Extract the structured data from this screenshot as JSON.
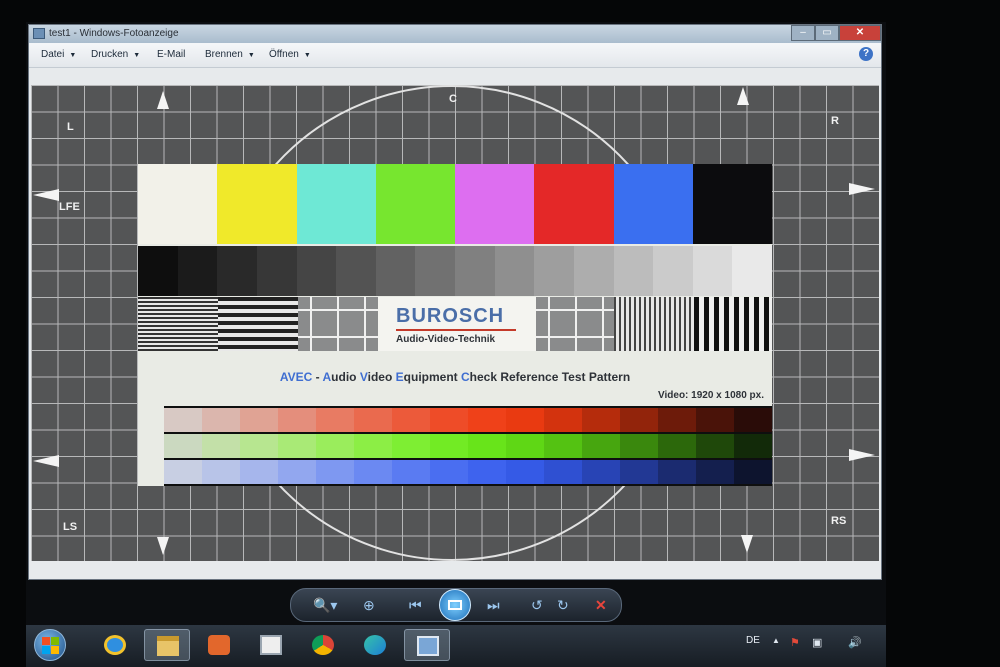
{
  "window": {
    "title": "test1 - Windows-Fotoanzeige",
    "controls": {
      "minimize": "–",
      "maximize": "▭",
      "close": "✕"
    }
  },
  "menubar": {
    "items": [
      {
        "label": "Datei",
        "has_dropdown": true
      },
      {
        "label": "Drucken",
        "has_dropdown": true
      },
      {
        "label": "E-Mail",
        "has_dropdown": false
      },
      {
        "label": "Brennen",
        "has_dropdown": true
      },
      {
        "label": "Öffnen",
        "has_dropdown": true
      }
    ],
    "help_label": "?"
  },
  "test_pattern": {
    "channels": {
      "top_left": "L",
      "top_center": "C",
      "top_right": "R",
      "left_mid": "LFE",
      "bottom_left": "LS",
      "bottom_right": "RS"
    },
    "color_bars": [
      "#f2f1e9",
      "#f0e92a",
      "#6ee8d5",
      "#77e62f",
      "#dd6ef0",
      "#e42828",
      "#3a6ff0",
      "#0c0c0e"
    ],
    "gray_ramp": [
      "#0e0e0e",
      "#1b1b1b",
      "#292929",
      "#373737",
      "#454545",
      "#535353",
      "#626262",
      "#717171",
      "#808080",
      "#8f8f8f",
      "#9e9e9e",
      "#adadad",
      "#bcbcbc",
      "#cbcbcb",
      "#dadada",
      "#e9e9e9"
    ],
    "logo": {
      "name": "BUROSCH",
      "subtitle": "Audio-Video-Technik"
    },
    "tagline": {
      "parts": [
        {
          "text": "AVEC",
          "highlight": true
        },
        {
          "text": " - ",
          "highlight": false
        },
        {
          "text": "A",
          "highlight": true
        },
        {
          "text": "udio ",
          "highlight": false
        },
        {
          "text": "V",
          "highlight": true
        },
        {
          "text": "ideo ",
          "highlight": false
        },
        {
          "text": "E",
          "highlight": true
        },
        {
          "text": "quipment ",
          "highlight": false
        },
        {
          "text": "C",
          "highlight": true
        },
        {
          "text": "heck Reference Test Pattern",
          "highlight": false
        }
      ]
    },
    "resolution": "Video: 1920 x 1080 px.",
    "saturation_ramps": {
      "red": [
        "#d8c9c4",
        "#dbb6ad",
        "#e0a394",
        "#e48e7c",
        "#e87b63",
        "#ea6a4e",
        "#ec5a3a",
        "#ee4c28",
        "#ef4119",
        "#e93a11",
        "#d3330e",
        "#b52c0c",
        "#92240b",
        "#6d1b0a",
        "#4a1309",
        "#2a0c08"
      ],
      "green": [
        "#cbd9c0",
        "#c3e0a8",
        "#b7e690",
        "#a9ea76",
        "#9aed5c",
        "#8cee45",
        "#7eee33",
        "#72eb24",
        "#68e41a",
        "#5fd715",
        "#54c212",
        "#47a60f",
        "#3a880d",
        "#2c680b",
        "#1f480a",
        "#122a09"
      ],
      "blue": [
        "#c8cfe3",
        "#b8c4e8",
        "#a6b6ec",
        "#92a7ef",
        "#7e98f1",
        "#6b89f2",
        "#5a7bf2",
        "#4a6ef1",
        "#3e63ee",
        "#355ae6",
        "#2f50d2",
        "#2844b5",
        "#223894",
        "#1b2b70",
        "#141f4e",
        "#0d142e"
      ]
    }
  },
  "toolbar": {
    "buttons": [
      {
        "name": "zoom",
        "glyph": "🔍▾"
      },
      {
        "name": "actual-size",
        "glyph": "⊕"
      },
      {
        "name": "previous",
        "glyph": "⏮"
      },
      {
        "name": "slideshow",
        "glyph": ""
      },
      {
        "name": "next",
        "glyph": "⏭"
      },
      {
        "name": "rotate-left",
        "glyph": "↺"
      },
      {
        "name": "rotate-right",
        "glyph": "↻"
      },
      {
        "name": "delete",
        "glyph": "✕"
      }
    ]
  },
  "taskbar": {
    "apps": [
      "internet-explorer",
      "file-explorer",
      "media-player",
      "notepad",
      "chrome",
      "edge",
      "photo-viewer"
    ],
    "tray": {
      "language": "DE",
      "up_arrow": "▲",
      "flag": "⚑",
      "network": "▣",
      "volume": "🔊"
    }
  }
}
